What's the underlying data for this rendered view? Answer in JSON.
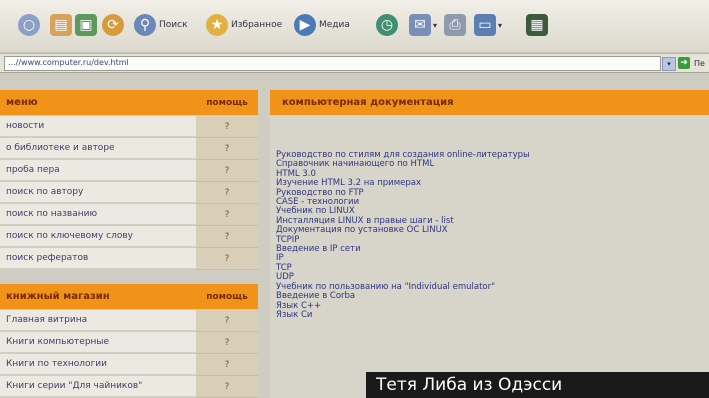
{
  "toolbar": {
    "search_label": "Поиск",
    "favorites_label": "Избранное",
    "media_label": "Медиа"
  },
  "address": {
    "text": "...//www.computer.ru/dev.html",
    "go_label": "Пе"
  },
  "menu": {
    "header": "меню",
    "help_header": "помощь",
    "items": [
      {
        "label": "новости",
        "help": "?"
      },
      {
        "label": "о библиотеке и авторе",
        "help": "?"
      },
      {
        "label": "проба пера",
        "help": "?"
      },
      {
        "label": "поиск по автору",
        "help": "?"
      },
      {
        "label": "поиск по названию",
        "help": "?"
      },
      {
        "label": "поиск по ключевому слову",
        "help": "?"
      },
      {
        "label": "поиск рефератов",
        "help": "?"
      }
    ]
  },
  "shop": {
    "header": "книжный магазин",
    "help_header": "помощь",
    "items": [
      {
        "label": "Главная витрина",
        "help": "?"
      },
      {
        "label": "Книги компьютерные",
        "help": "?"
      },
      {
        "label": "Книги по технологии",
        "help": "?"
      },
      {
        "label": "Книги серии \"Для чайников\"",
        "help": "?"
      }
    ]
  },
  "docs": {
    "header": "компьютерная документация",
    "items": [
      "Руководство по стилям для создания online-литературы",
      "Справочник начинающего по HTML",
      "HTML 3.0",
      "Изучение HTML 3.2 на примерах",
      "Руководство по FTP",
      "CASE - технологии",
      "Учебник по LINUX",
      "Инсталляция LINUX в правые шаги - list",
      "Документация по установке OC LINUX",
      "TCPIP",
      "Введение в IP сети",
      "IP",
      "TCP",
      "UDP",
      "Учебник по пользованию на \"Individual emulator\"",
      "Введение в Corba",
      "Язык C++",
      "Язык Си"
    ]
  },
  "caption": {
    "text": "Тетя Либа из Одэсси"
  }
}
